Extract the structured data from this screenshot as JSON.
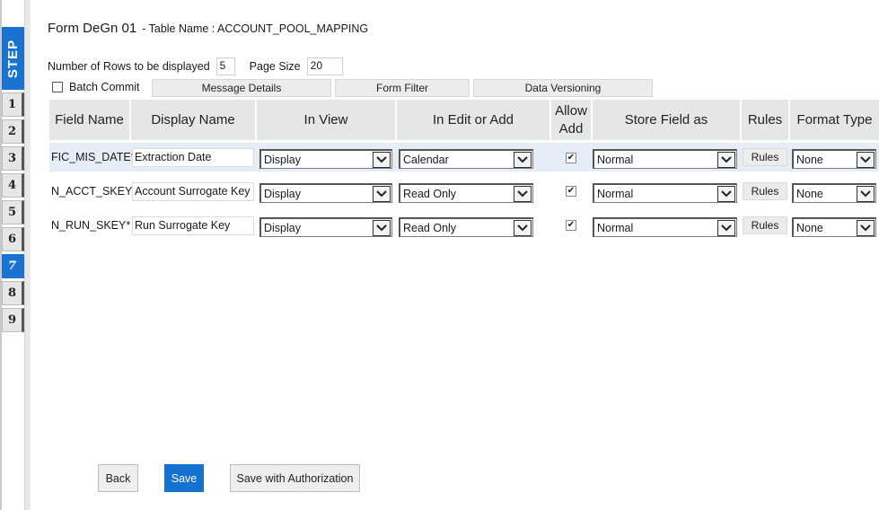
{
  "steps": {
    "label": "STEP",
    "items": [
      "1",
      "2",
      "3",
      "4",
      "5",
      "6",
      "7",
      "8",
      "9"
    ],
    "active": "7"
  },
  "header": {
    "title": "Form DeGn 01",
    "table_name": "- Table Name : ACCOUNT_POOL_MAPPING"
  },
  "settings": {
    "rows_label": "Number of Rows to be displayed",
    "rows_value": "5",
    "page_size_label": "Page Size",
    "page_size_value": "20",
    "batch_commit_label": "Batch Commit",
    "batch_commit_checked": false
  },
  "toolbar": {
    "message_details": "Message Details",
    "form_filter": "Form Filter",
    "data_versioning": "Data Versioning"
  },
  "table": {
    "headers": {
      "field_name": "Field Name",
      "display_name": "Display Name",
      "in_view": "In View",
      "in_edit_or_add": "In Edit or Add",
      "allow_add_1": "Allow",
      "allow_add_2": "Add",
      "store_field_as": "Store Field as",
      "rules": "Rules",
      "format_type": "Format Type"
    },
    "rows": [
      {
        "field_name": "FIC_MIS_DATE*",
        "display_name": "Extraction Date",
        "in_view": "Display",
        "in_edit_or_add": "Calendar",
        "allow_add": true,
        "store_field_as": "Normal",
        "rules": "Rules",
        "format_type": "None"
      },
      {
        "field_name": "N_ACCT_SKEY*",
        "display_name": "Account Surrogate Key",
        "in_view": "Display",
        "in_edit_or_add": "Read Only",
        "allow_add": true,
        "store_field_as": "Normal",
        "rules": "Rules",
        "format_type": "None"
      },
      {
        "field_name": "N_RUN_SKEY*",
        "display_name": "Run Surrogate Key",
        "in_view": "Display",
        "in_edit_or_add": "Read Only",
        "allow_add": true,
        "store_field_as": "Normal",
        "rules": "Rules",
        "format_type": "None"
      }
    ]
  },
  "actions": {
    "back": "Back",
    "save": "Save",
    "save_with_authorization": "Save with Authorization"
  },
  "colors": {
    "accent": "#1a73d1",
    "header_bg": "#e6e6e6",
    "row_highlight": "#e7edf6"
  },
  "icons": {
    "dropdown": "chevron-down-icon",
    "check": "checkmark-icon"
  }
}
